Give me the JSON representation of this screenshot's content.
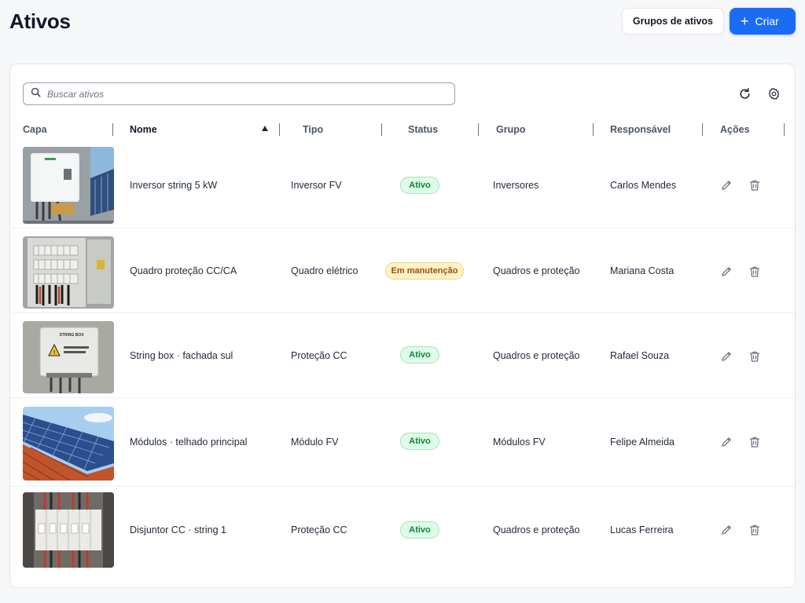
{
  "header": {
    "title": "Ativos",
    "groups_button": "Grupos de ativos",
    "create_button": "Criar"
  },
  "toolbar": {
    "search_placeholder": "Buscar ativos",
    "refresh_icon": "refresh-icon",
    "settings_icon": "gear-icon"
  },
  "table": {
    "columns": [
      "Capa",
      "Nome",
      "Tipo",
      "Status",
      "Grupo",
      "Responsável",
      "Ações"
    ],
    "sort": {
      "column": "Nome",
      "direction": "asc"
    },
    "rows": [
      {
        "nome": "Inversor string 5 kW",
        "tipo": "Inversor FV",
        "status": "Ativo",
        "grupo": "Inversores",
        "responsavel": "Carlos Mendes"
      },
      {
        "nome": "Quadro proteção CC/CA",
        "tipo": "Quadro elétrico",
        "status": "Em manutenção",
        "grupo": "Quadros e proteção",
        "responsavel": "Mariana Costa"
      },
      {
        "nome": "String box · fachada sul",
        "tipo": "Proteção CC",
        "status": "Ativo",
        "grupo": "Quadros e proteção",
        "responsavel": "Rafael Souza",
        "thumb_label": "STRING BOX"
      },
      {
        "nome": "Módulos · telhado principal",
        "tipo": "Módulo FV",
        "status": "Ativo",
        "grupo": "Módulos FV",
        "responsavel": "Felipe Almeida"
      },
      {
        "nome": "Disjuntor CC · string 1",
        "tipo": "Proteção CC",
        "status": "Ativo",
        "grupo": "Quadros e proteção",
        "responsavel": "Lucas Ferreira"
      }
    ]
  },
  "colors": {
    "primary": "#1a6cf5",
    "active_badge_bg": "#dcfce7",
    "active_badge_text": "#15803d",
    "maintenance_badge_bg": "#fef3c7",
    "maintenance_badge_text": "#a34a10"
  }
}
